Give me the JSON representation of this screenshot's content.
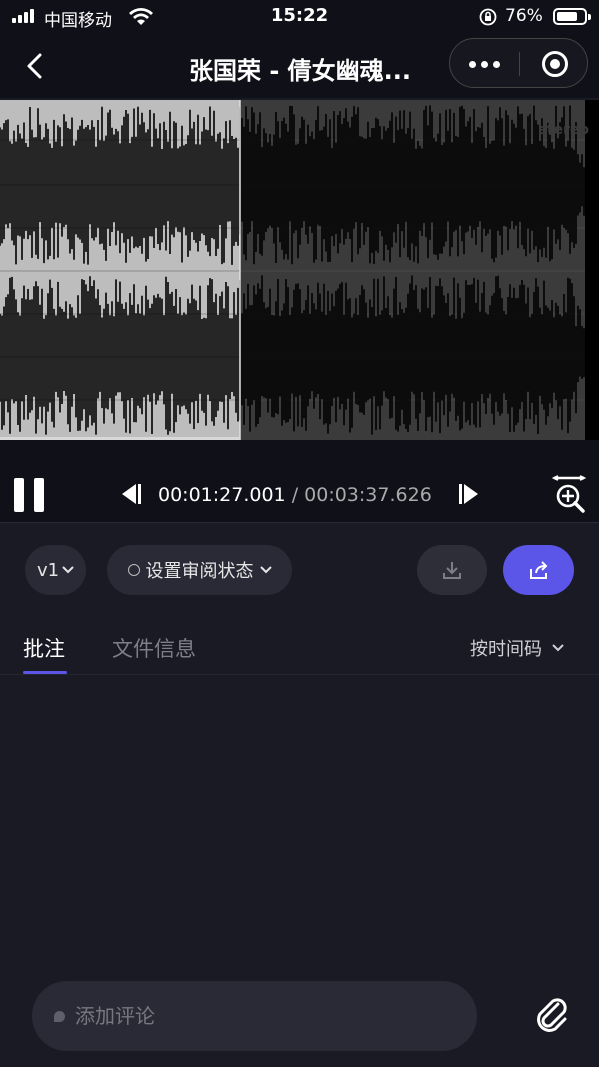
{
  "status_bar": {
    "carrier": "中国移动",
    "time": "15:22",
    "battery": "76%",
    "battery_level": 0.76
  },
  "nav": {
    "title": "张国荣 - 倩女幽魂...",
    "back_icon": "chevron-left-icon",
    "more_icon": "more-dots-icon",
    "close_icon": "target-close-icon"
  },
  "waveform": {
    "channel_label": "stereo",
    "played_fraction": 0.4
  },
  "player": {
    "current_time": "00:01:27.001",
    "separator": "/",
    "total_time": "00:03:37.626"
  },
  "actions": {
    "version": "v1",
    "review_status": "设置审阅状态",
    "download_icon": "download-icon",
    "share_icon": "share-icon"
  },
  "tabs": {
    "comments": "批注",
    "file_info": "文件信息",
    "sort": "按时间码"
  },
  "comment_box": {
    "placeholder": "添加评论"
  },
  "colors": {
    "accent": "#5b56e8",
    "background": "#1a1a24",
    "played_wave": "#c8c8c8",
    "unplayed_wave": "#3a3a3a"
  }
}
